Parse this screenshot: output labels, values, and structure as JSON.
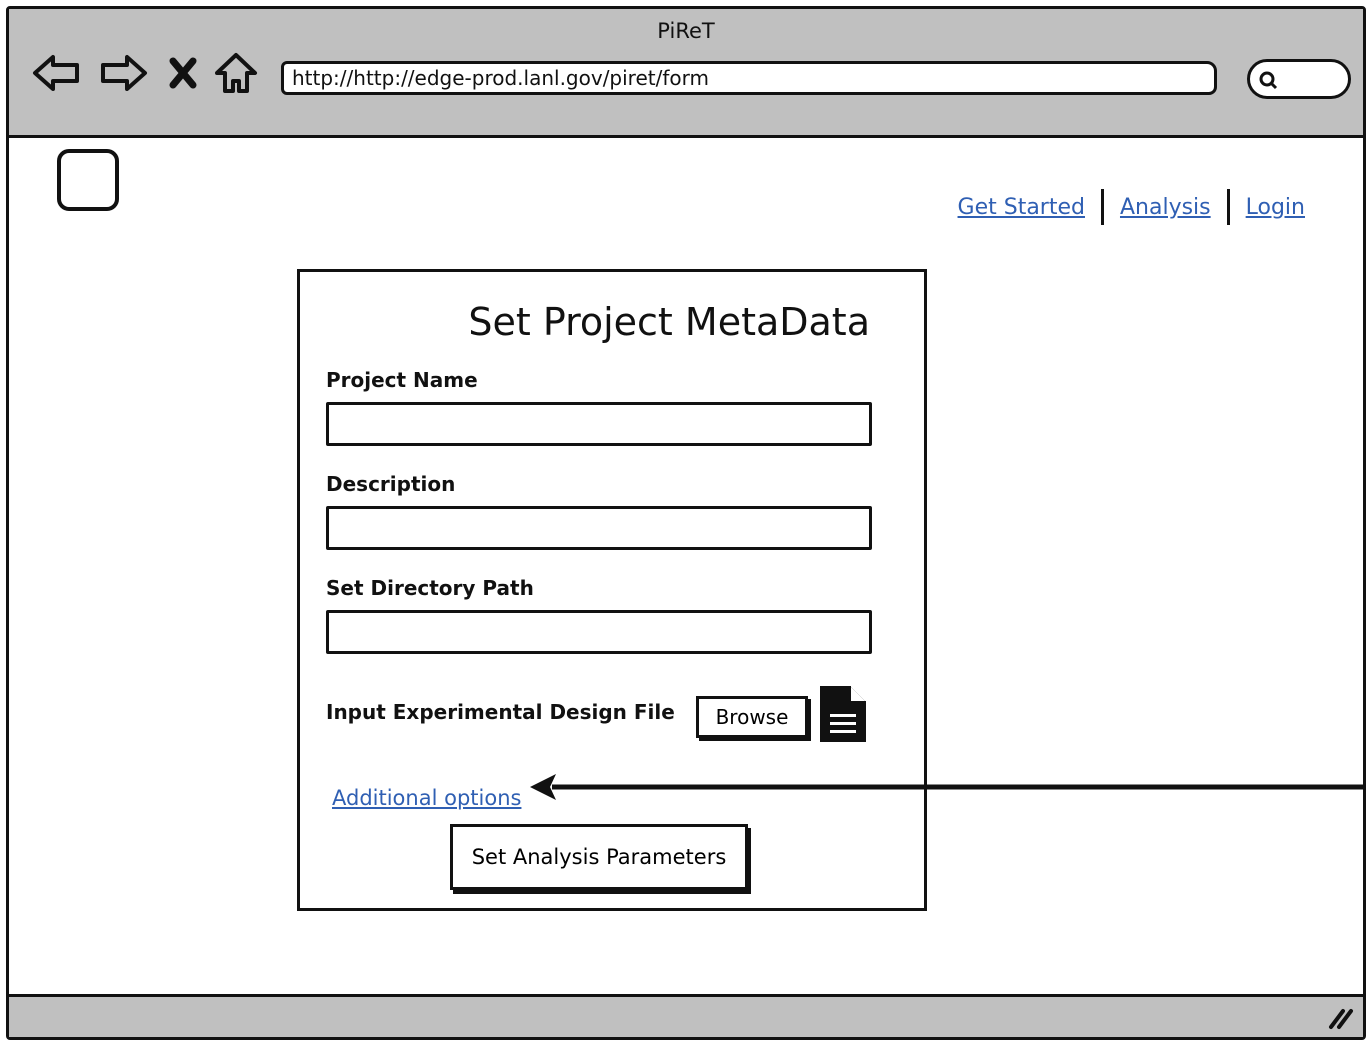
{
  "window": {
    "title": "PiReT",
    "url": "http://http://edge-prod.lanl.gov/piret/form"
  },
  "toolbar": {
    "back_icon": "back-arrow-icon",
    "forward_icon": "forward-arrow-icon",
    "stop_icon": "close-icon",
    "home_icon": "home-icon",
    "search_icon": "search-icon"
  },
  "header": {
    "links": [
      "Get Started",
      "Analysis",
      "Login"
    ]
  },
  "form": {
    "title": "Set Project MetaData",
    "project_name_label": "Project Name",
    "project_name_value": "",
    "description_label": "Description",
    "description_value": "",
    "directory_label": "Set Directory Path",
    "directory_value": "",
    "design_file_label": "Input Experimental Design File",
    "browse_label": "Browse",
    "file_icon": "document-icon",
    "additional_options": "Additional options",
    "submit_label": "Set Analysis Parameters"
  },
  "colors": {
    "link": "#2f5fb3",
    "chrome": "#c0c0c0",
    "outline": "#111111"
  }
}
